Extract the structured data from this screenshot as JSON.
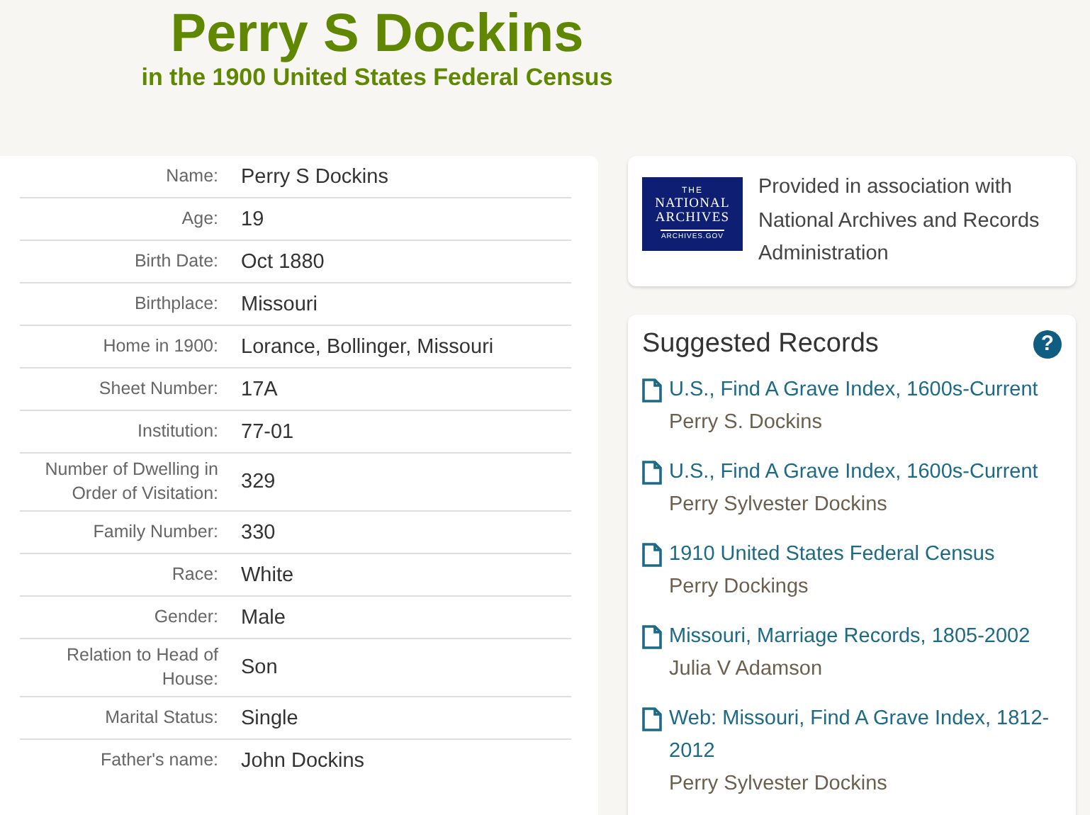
{
  "header": {
    "title": "Perry S Dockins",
    "subtitle": "in the 1900 United States Federal Census"
  },
  "details": [
    {
      "label": "Name:",
      "value": "Perry S Dockins"
    },
    {
      "label": "Age:",
      "value": "19"
    },
    {
      "label": "Birth Date:",
      "value": "Oct 1880"
    },
    {
      "label": "Birthplace:",
      "value": "Missouri"
    },
    {
      "label": "Home in 1900:",
      "value": "Lorance, Bollinger, Missouri"
    },
    {
      "label": "Sheet Number:",
      "value": "17A"
    },
    {
      "label": "Institution:",
      "value": "77-01"
    },
    {
      "label": "Number of Dwelling in Order of Visitation:",
      "value": "329"
    },
    {
      "label": "Family Number:",
      "value": "330"
    },
    {
      "label": "Race:",
      "value": "White"
    },
    {
      "label": "Gender:",
      "value": "Male"
    },
    {
      "label": "Relation to Head of House:",
      "value": "Son"
    },
    {
      "label": "Marital Status:",
      "value": "Single"
    },
    {
      "label": "Father's name:",
      "value": "John Dockins"
    }
  ],
  "provider": {
    "logo_lines": [
      "THE",
      "NATIONAL",
      "ARCHIVES",
      "ARCHIVES.GOV"
    ],
    "text": "Provided in association with National Archives and Records Administration"
  },
  "suggested_records": {
    "title": "Suggested Records",
    "help": "?",
    "records": [
      {
        "collection": "U.S., Find A Grave Index, 1600s-Current",
        "person": "Perry S. Dockins"
      },
      {
        "collection": "U.S., Find A Grave Index, 1600s-Current",
        "person": "Perry Sylvester Dockins"
      },
      {
        "collection": "1910 United States Federal Census",
        "person": "Perry Dockings"
      },
      {
        "collection": "Missouri, Marriage Records, 1805-2002",
        "person": "Julia V Adamson"
      },
      {
        "collection": "Web: Missouri, Find A Grave Index, 1812-2012",
        "person": "Perry Sylvester Dockins"
      }
    ]
  }
}
